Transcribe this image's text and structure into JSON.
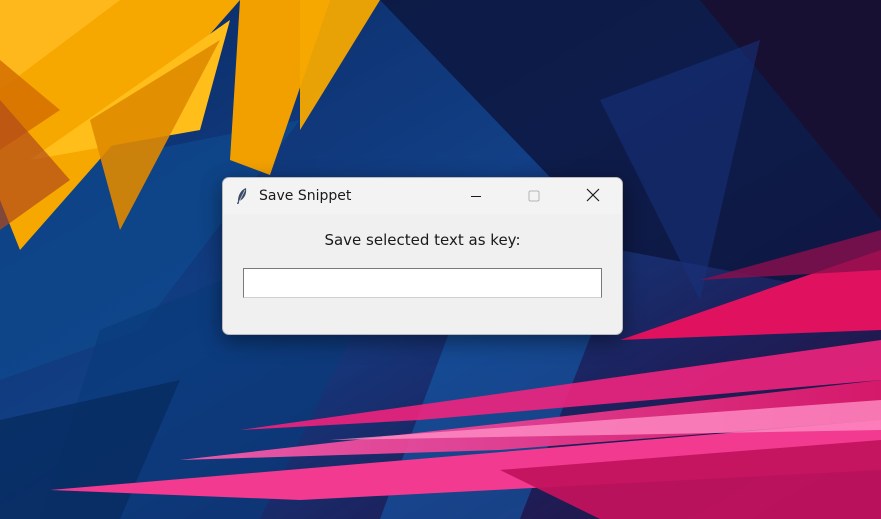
{
  "window": {
    "title": "Save Snippet",
    "icon": "feather-icon",
    "controls": [
      "minimize-icon",
      "maximize-icon",
      "close-icon"
    ]
  },
  "dialog": {
    "prompt": "Save selected text as key:",
    "key_input": {
      "value": "",
      "placeholder": ""
    }
  },
  "colors": {
    "dialog_bg": "#f0f0f0",
    "wallpaper_base": "#0a1a3f",
    "wallpaper_yellow": "#f7a800",
    "wallpaper_pink": "#f0237d",
    "wallpaper_blue": "#1a4f9a"
  }
}
